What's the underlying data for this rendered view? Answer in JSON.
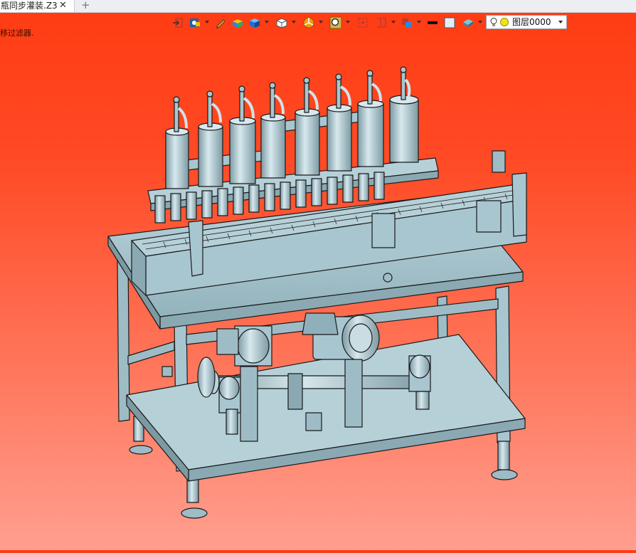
{
  "tab": {
    "title": "瓶同步灌装.Z3",
    "close_glyph": "✕",
    "add_glyph": "+"
  },
  "status_note": "移过滤器.",
  "toolbar": {
    "buttons": [
      {
        "name": "insert-icon"
      },
      {
        "name": "view-style-icon"
      },
      {
        "name": "pen-icon"
      },
      {
        "name": "color-box-icon"
      },
      {
        "name": "blue-cube-icon"
      },
      {
        "name": "wire-cube-icon"
      },
      {
        "name": "pie-icon"
      },
      {
        "name": "zoom-icon"
      },
      {
        "name": "clip-icon"
      },
      {
        "name": "section-icon"
      },
      {
        "name": "layer-props-icon"
      },
      {
        "name": "line-color-icon"
      },
      {
        "name": "fill-color-icon"
      },
      {
        "name": "surface-icon"
      }
    ],
    "layer_value": "图层0000"
  },
  "colors": {
    "bg_top": "#ff3b12",
    "bg_bottom": "#ff9f8f",
    "metal": "#a8c6d0",
    "metal_dark": "#7d9aa3",
    "outline": "#1a1a1a"
  }
}
